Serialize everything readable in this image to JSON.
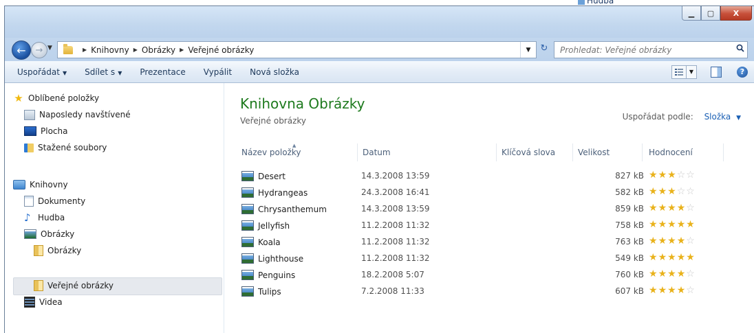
{
  "desktop": {
    "peek_label": "Hudba"
  },
  "window": {
    "caption_buttons": {
      "minimize": "▁",
      "maximize": "▢",
      "close": "X"
    }
  },
  "address_bar": {
    "crumbs": [
      "Knihovny",
      "Obrázky",
      "Veřejné obrázky"
    ]
  },
  "search": {
    "placeholder": "Prohledat: Veřejné obrázky"
  },
  "toolbar": {
    "organize": "Uspořádat",
    "share_with": "Sdílet s",
    "slideshow": "Prezentace",
    "burn": "Vypálit",
    "new_folder": "Nová složka"
  },
  "sidebar": {
    "favorites": {
      "label": "Oblíbené položky",
      "items": [
        "Naposledy navštívené",
        "Plocha",
        "Stažené soubory"
      ]
    },
    "libraries": {
      "label": "Knihovny",
      "items": [
        "Dokumenty",
        "Hudba",
        "Obrázky"
      ],
      "pictures_children": [
        "Obrázky",
        "Veřejné obrázky"
      ],
      "videos": "Videa"
    },
    "selected": "Veřejné obrázky"
  },
  "content": {
    "title": "Knihovna Obrázky",
    "subtitle": "Veřejné obrázky",
    "arrange_label": "Uspořádat podle:",
    "arrange_value": "Složka",
    "columns": [
      "Název položky",
      "Datum",
      "Klíčová slova",
      "Velikost",
      "Hodnocení"
    ],
    "files": [
      {
        "name": "Desert",
        "date": "14.3.2008 13:59",
        "size": "827 kB",
        "rating": 3
      },
      {
        "name": "Hydrangeas",
        "date": "24.3.2008 16:41",
        "size": "582 kB",
        "rating": 3
      },
      {
        "name": "Chrysanthemum",
        "date": "14.3.2008 13:59",
        "size": "859 kB",
        "rating": 4
      },
      {
        "name": "Jellyfish",
        "date": "11.2.2008 11:32",
        "size": "758 kB",
        "rating": 5
      },
      {
        "name": "Koala",
        "date": "11.2.2008 11:32",
        "size": "763 kB",
        "rating": 4
      },
      {
        "name": "Lighthouse",
        "date": "11.2.2008 11:32",
        "size": "549 kB",
        "rating": 5
      },
      {
        "name": "Penguins",
        "date": "18.2.2008 5:07",
        "size": "760 kB",
        "rating": 4
      },
      {
        "name": "Tulips",
        "date": "7.2.2008 11:33",
        "size": "607 kB",
        "rating": 4
      }
    ]
  },
  "colors": {
    "library_title": "#1e7a1e",
    "link": "#1a5fb4",
    "star_on": "#e9b21b",
    "star_off": "#c9c9c9"
  }
}
